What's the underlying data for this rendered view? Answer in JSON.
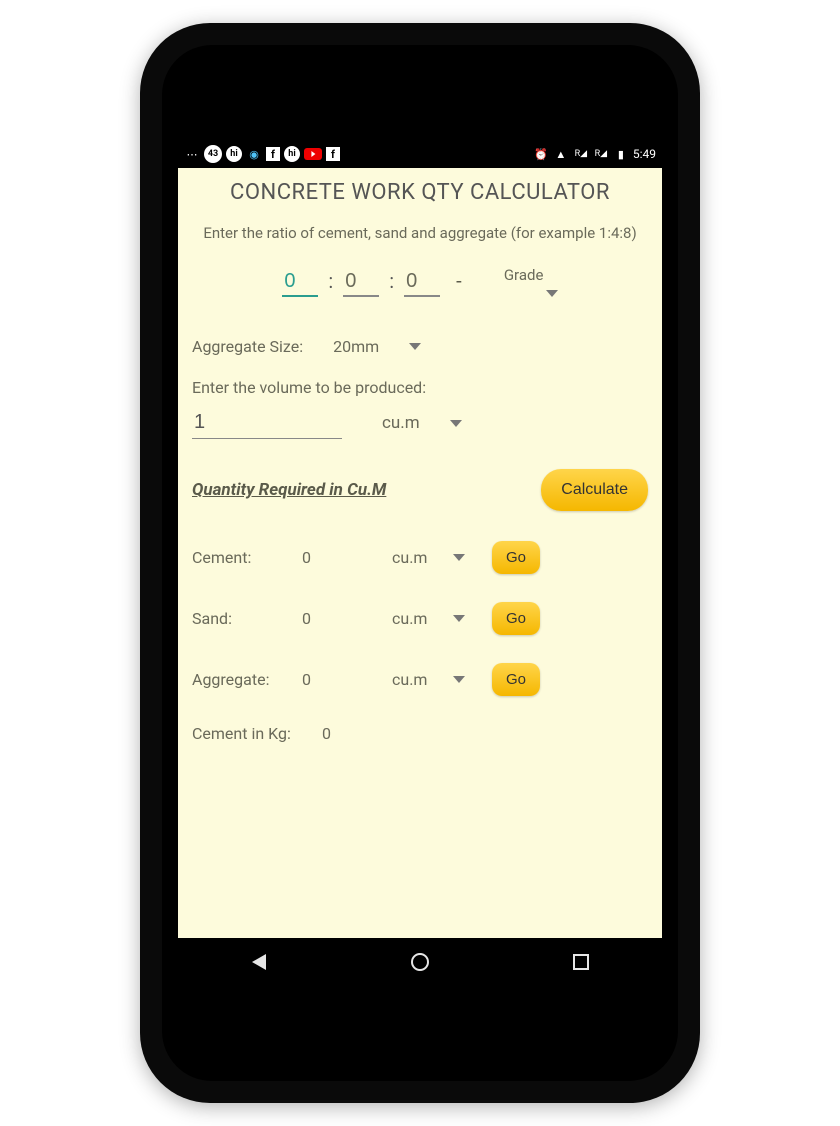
{
  "status": {
    "badge": "43",
    "time": "5:49"
  },
  "app": {
    "title": "CONCRETE WORK QTY CALCULATOR",
    "subtitle": "Enter the ratio of cement, sand and aggregate (for example 1:4:8)",
    "ratio": {
      "cement": "0",
      "sand": "0",
      "aggregate": "0"
    },
    "grade_label": "Grade",
    "aggregate_label": "Aggregate Size:",
    "aggregate_value": "20mm",
    "volume_label": "Enter the volume to be produced:",
    "volume_value": "1",
    "volume_unit": "cu.m",
    "qty_title": "Quantity Required in Cu.M",
    "calc_label": "Calculate",
    "go_label": "Go",
    "results": {
      "cement": {
        "label": "Cement:",
        "value": "0",
        "unit": "cu.m"
      },
      "sand": {
        "label": "Sand:",
        "value": "0",
        "unit": "cu.m"
      },
      "aggregate": {
        "label": "Aggregate:",
        "value": "0",
        "unit": "cu.m"
      },
      "cement_kg": {
        "label": "Cement in Kg:",
        "value": "0"
      }
    }
  }
}
